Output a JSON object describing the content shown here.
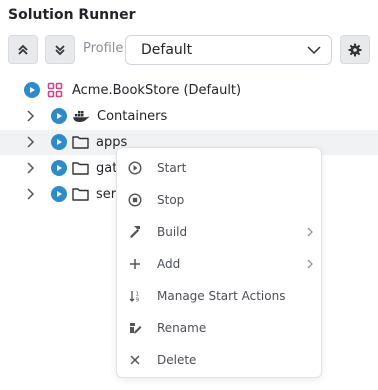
{
  "panel": {
    "title": "Solution Runner"
  },
  "toolbar": {
    "expand_all_icon": "double-chevron-up-icon",
    "collapse_all_icon": "double-chevron-down-icon",
    "profile_label": "Profile:",
    "profile_value": "Default",
    "settings_icon": "gear-icon"
  },
  "tree": {
    "root": {
      "label": "Acme.BookStore (Default)"
    },
    "items": [
      {
        "label": "Containers",
        "icon": "docker-icon"
      },
      {
        "label": "apps",
        "icon": "folder-icon"
      },
      {
        "label": "gat",
        "icon": "folder-icon"
      },
      {
        "label": "serv",
        "icon": "folder-icon"
      }
    ]
  },
  "context_menu": {
    "items": [
      {
        "label": "Start",
        "icon": "play-circle-icon",
        "submenu": false
      },
      {
        "label": "Stop",
        "icon": "stop-circle-icon",
        "submenu": false
      },
      {
        "label": "Build",
        "icon": "hammer-icon",
        "submenu": true
      },
      {
        "label": "Add",
        "icon": "plus-icon",
        "submenu": true
      },
      {
        "label": "Manage Start Actions",
        "icon": "sort-icon",
        "submenu": false
      },
      {
        "label": "Rename",
        "icon": "pencil-icon",
        "submenu": false
      },
      {
        "label": "Delete",
        "icon": "x-icon",
        "submenu": false
      }
    ]
  },
  "colors": {
    "accent": "#2e8bc9",
    "project_icon": "#c8448b"
  }
}
